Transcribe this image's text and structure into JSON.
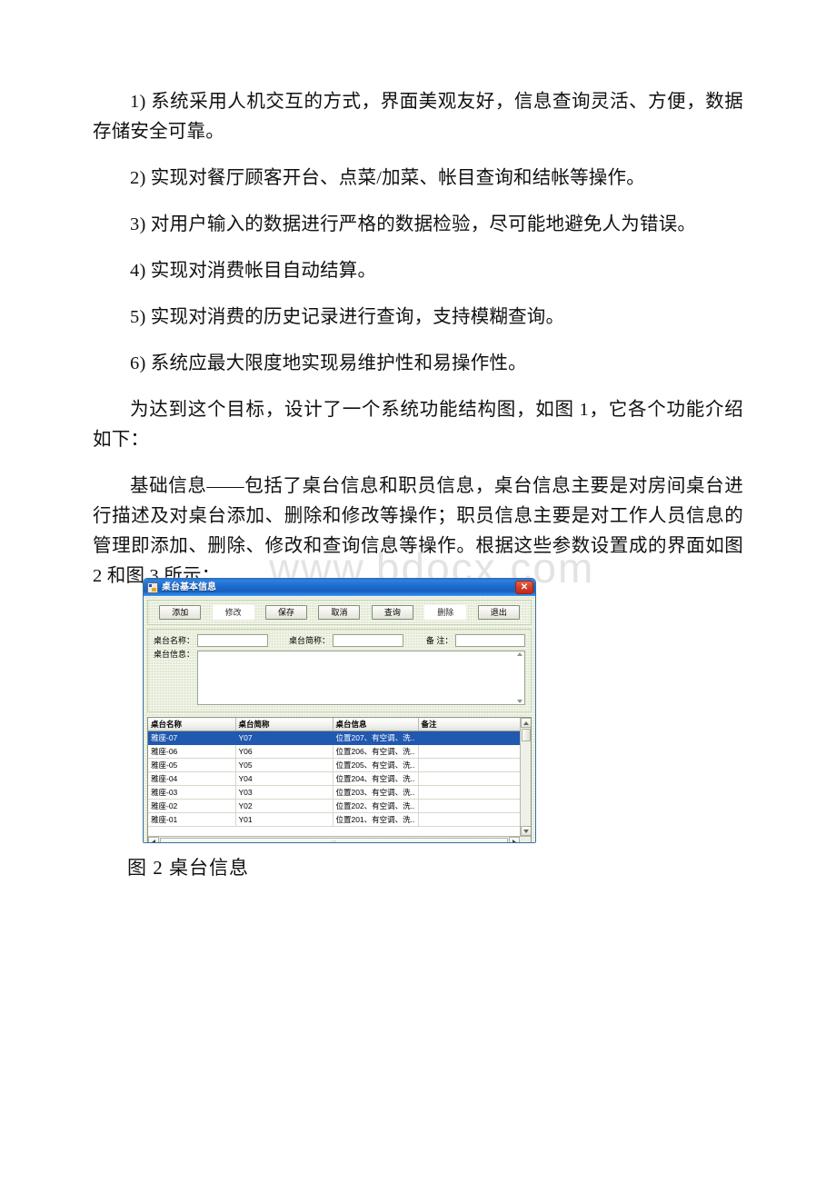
{
  "document": {
    "paragraphs": [
      "1) 系统采用人机交互的方式，界面美观友好，信息查询灵活、方便，数据存储安全可靠。",
      "2) 实现对餐厅顾客开台、点菜/加菜、帐目查询和结帐等操作。",
      "3) 对用户输入的数据进行严格的数据检验，尽可能地避免人为错误。",
      "4) 实现对消费帐目自动结算。",
      "5) 实现对消费的历史记录进行查询，支持模糊查询。",
      "6) 系统应最大限度地实现易维护性和易操作性。",
      "为达到这个目标，设计了一个系统功能结构图，如图 1，它各个功能介绍如下：",
      "基础信息——包括了桌台信息和职员信息，桌台信息主要是对房间桌台进行描述及对桌台添加、删除和修改等操作；职员信息主要是对工作人员信息的管理即添加、删除、修改和查询信息等操作。根据这些参数设置成的界面如图 2 和图 3 所示；"
    ],
    "figure_caption": "图 2 桌台信息",
    "watermark": "www.bdocx.com"
  },
  "app": {
    "title": "桌台基本信息",
    "close_label": "✕",
    "accent_titlebar": "#1f6ccb",
    "accent_close": "#d7402c",
    "accent_selection": "#2158b0",
    "toolbar": {
      "buttons": [
        {
          "label": "添加",
          "enabled": true
        },
        {
          "label": "修改",
          "enabled": false
        },
        {
          "label": "保存",
          "enabled": true
        },
        {
          "label": "取消",
          "enabled": true
        },
        {
          "label": "查询",
          "enabled": true
        },
        {
          "label": "删除",
          "enabled": false
        },
        {
          "label": "退出",
          "enabled": true
        }
      ]
    },
    "form": {
      "name_label": "桌台名称：",
      "name_value": "",
      "abbr_label": "桌台简称：",
      "abbr_value": "",
      "note_label": "备 注：",
      "note_value": "",
      "info_label": "桌台信息：",
      "info_value": ""
    },
    "grid": {
      "columns": [
        "桌台名称",
        "桌台简称",
        "桌台信息",
        "备注"
      ],
      "rows": [
        {
          "name": "雅座-07",
          "abbr": "Y07",
          "info": "位置207、有空调、洗..",
          "note": "",
          "selected": true
        },
        {
          "name": "雅座-06",
          "abbr": "Y06",
          "info": "位置206、有空调、洗..",
          "note": "",
          "selected": false
        },
        {
          "name": "雅座-05",
          "abbr": "Y05",
          "info": "位置205、有空调、洗..",
          "note": "",
          "selected": false
        },
        {
          "name": "雅座-04",
          "abbr": "Y04",
          "info": "位置204、有空调、洗..",
          "note": "",
          "selected": false
        },
        {
          "name": "雅座-03",
          "abbr": "Y03",
          "info": "位置203、有空调、洗..",
          "note": "",
          "selected": false
        },
        {
          "name": "雅座-02",
          "abbr": "Y02",
          "info": "位置202、有空调、洗..",
          "note": "",
          "selected": false
        },
        {
          "name": "雅座-01",
          "abbr": "Y01",
          "info": "位置201、有空调、洗..",
          "note": "",
          "selected": false
        }
      ]
    }
  }
}
